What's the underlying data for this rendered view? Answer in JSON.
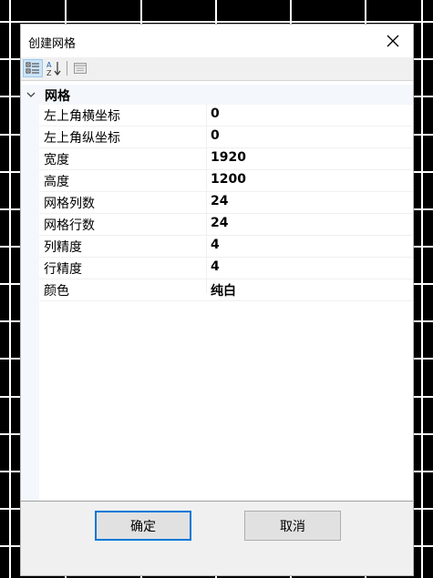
{
  "dialog": {
    "title": "创建网格",
    "ok_label": "确定",
    "cancel_label": "取消"
  },
  "toolbar": {
    "categorized_icon": "categorized-view-icon",
    "alphabetical_icon": "alphabetical-sort-icon",
    "property_pages_icon": "property-pages-icon"
  },
  "property_grid": {
    "category": "网格",
    "properties": [
      {
        "name": "左上角横坐标",
        "value": "0"
      },
      {
        "name": "左上角纵坐标",
        "value": "0"
      },
      {
        "name": "宽度",
        "value": "1920"
      },
      {
        "name": "高度",
        "value": "1200"
      },
      {
        "name": "网格列数",
        "value": "24"
      },
      {
        "name": "网格行数",
        "value": "24"
      },
      {
        "name": "列精度",
        "value": "4"
      },
      {
        "name": "行精度",
        "value": "4"
      },
      {
        "name": "颜色",
        "value": "纯白"
      }
    ]
  },
  "colors": {
    "background": "#000000",
    "grid_lines": "#ffffff",
    "accent": "#0078d7",
    "selected_tool": "#cce4f7"
  }
}
